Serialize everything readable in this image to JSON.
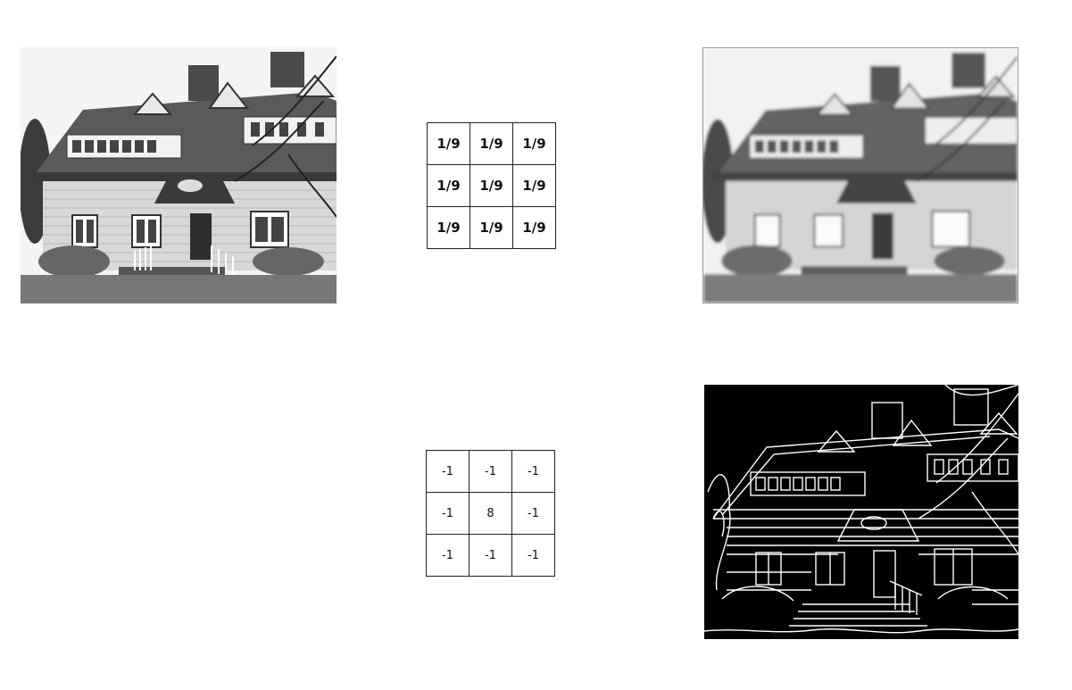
{
  "images": {
    "original": {
      "description_name": "original-house-photo"
    },
    "blurred": {
      "description_name": "smoothed-house-photo"
    },
    "edges": {
      "description_name": "edge-detected-house-photo"
    }
  },
  "kernels": {
    "averaging": [
      [
        "1/9",
        "1/9",
        "1/9"
      ],
      [
        "1/9",
        "1/9",
        "1/9"
      ],
      [
        "1/9",
        "1/9",
        "1/9"
      ]
    ],
    "laplacian": [
      [
        "-1",
        "-1",
        "-1"
      ],
      [
        "-1",
        "8",
        "-1"
      ],
      [
        "-1",
        "-1",
        "-1"
      ]
    ]
  },
  "colors": {
    "background": "#ffffff",
    "grid_border": "#222222",
    "edge_background": "#000000",
    "edge_lines": "#ffffff"
  }
}
